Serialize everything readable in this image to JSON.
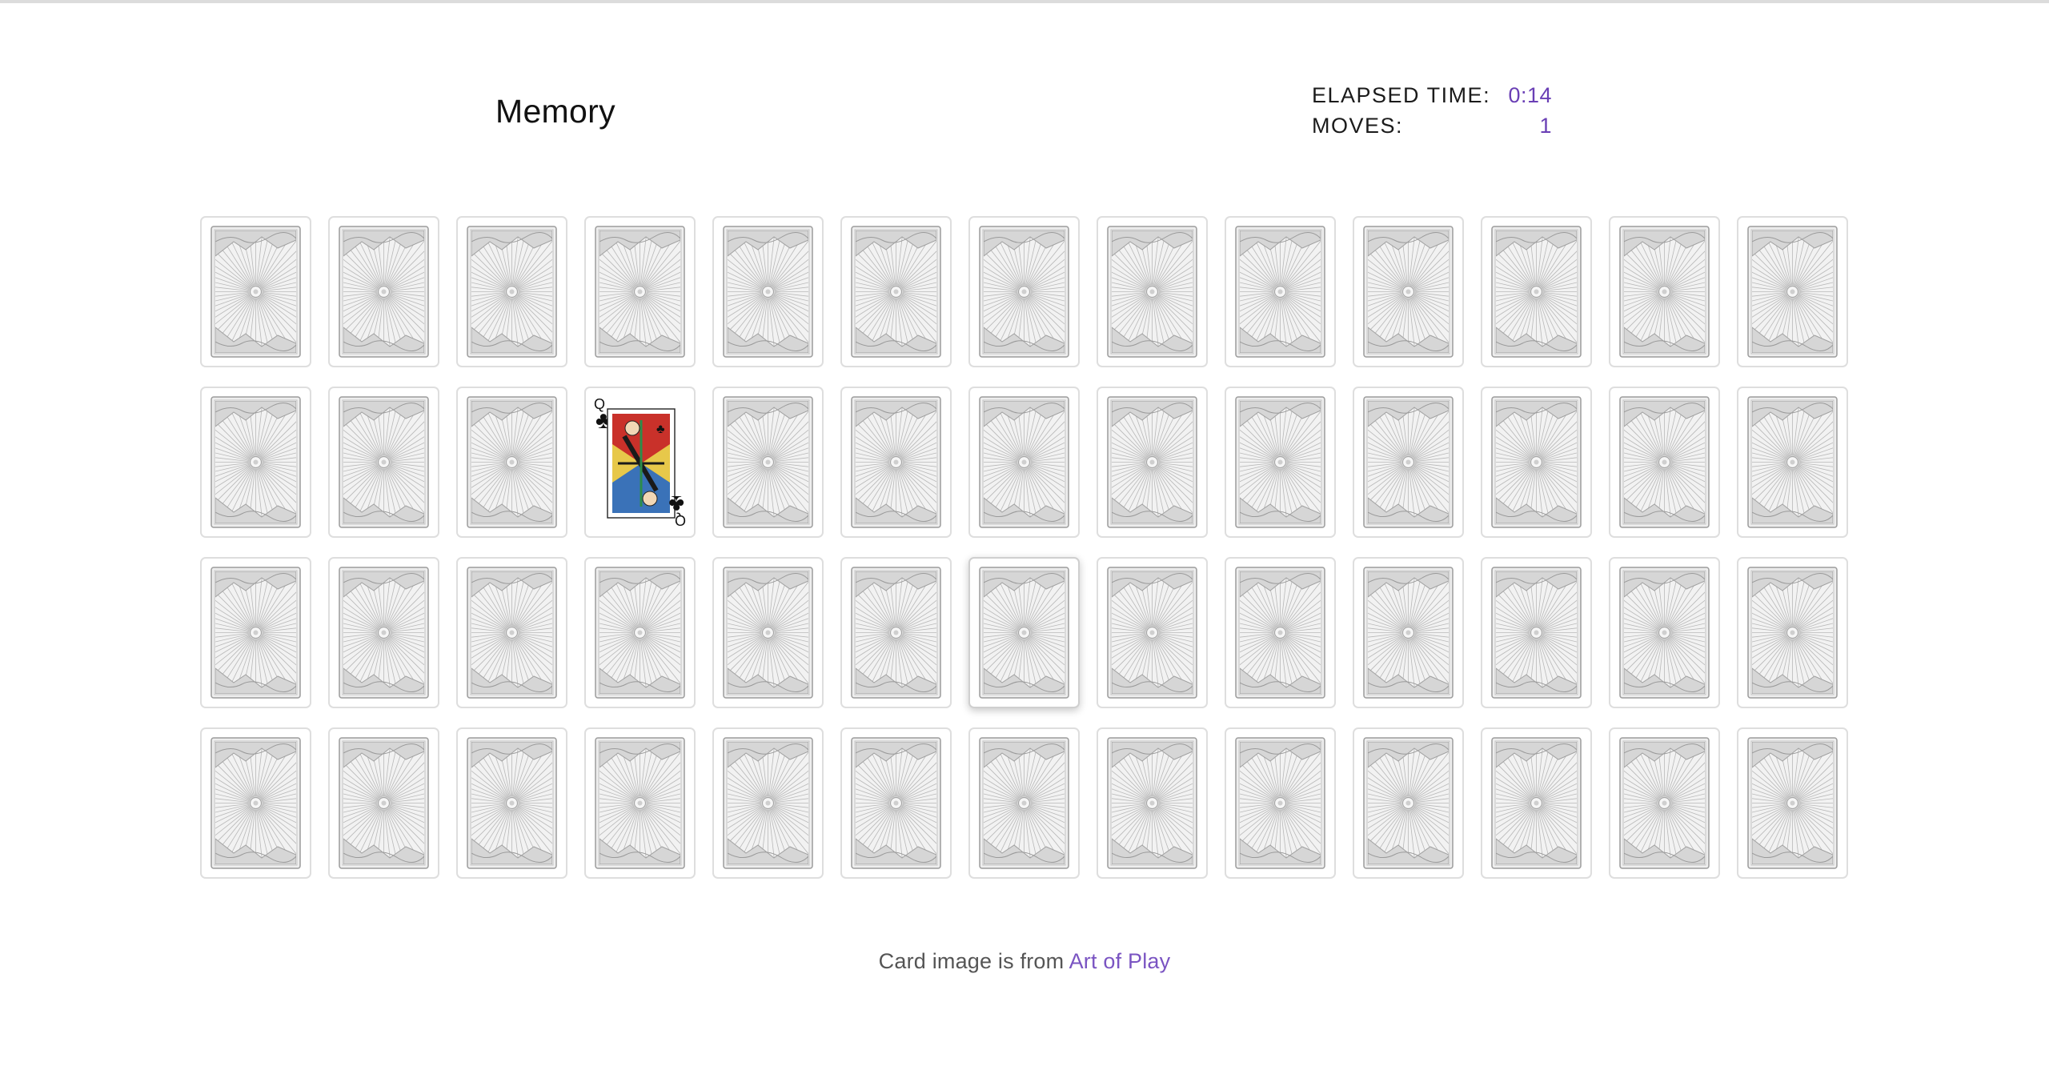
{
  "header": {
    "title": "Memory"
  },
  "stats": {
    "elapsed_label": "ELAPSED TIME:",
    "elapsed_value": "0:14",
    "moves_label": "MOVES:",
    "moves_value": "1"
  },
  "board": {
    "rows": 4,
    "columns": 13,
    "cards": [
      {
        "state": "face-down"
      },
      {
        "state": "face-down"
      },
      {
        "state": "face-down"
      },
      {
        "state": "face-down"
      },
      {
        "state": "face-down"
      },
      {
        "state": "face-down"
      },
      {
        "state": "face-down"
      },
      {
        "state": "face-down"
      },
      {
        "state": "face-down"
      },
      {
        "state": "face-down"
      },
      {
        "state": "face-down"
      },
      {
        "state": "face-down"
      },
      {
        "state": "face-down"
      },
      {
        "state": "face-down"
      },
      {
        "state": "face-down"
      },
      {
        "state": "face-down"
      },
      {
        "state": "face-up",
        "rank": "Q",
        "suit": "clubs",
        "suit_symbol": "♣"
      },
      {
        "state": "face-down"
      },
      {
        "state": "face-down"
      },
      {
        "state": "face-down"
      },
      {
        "state": "face-down"
      },
      {
        "state": "face-down"
      },
      {
        "state": "face-down"
      },
      {
        "state": "face-down"
      },
      {
        "state": "face-down"
      },
      {
        "state": "face-down"
      },
      {
        "state": "face-down"
      },
      {
        "state": "face-down"
      },
      {
        "state": "face-down"
      },
      {
        "state": "face-down"
      },
      {
        "state": "face-down"
      },
      {
        "state": "face-down"
      },
      {
        "state": "face-down",
        "hovered": true
      },
      {
        "state": "face-down"
      },
      {
        "state": "face-down"
      },
      {
        "state": "face-down"
      },
      {
        "state": "face-down"
      },
      {
        "state": "face-down"
      },
      {
        "state": "face-down"
      },
      {
        "state": "face-down"
      },
      {
        "state": "face-down"
      },
      {
        "state": "face-down"
      },
      {
        "state": "face-down"
      },
      {
        "state": "face-down"
      },
      {
        "state": "face-down"
      },
      {
        "state": "face-down"
      },
      {
        "state": "face-down"
      },
      {
        "state": "face-down"
      },
      {
        "state": "face-down"
      },
      {
        "state": "face-down"
      },
      {
        "state": "face-down"
      },
      {
        "state": "face-down"
      }
    ]
  },
  "footer": {
    "text": "Card image is from",
    "link_text": "Art of Play"
  },
  "colors": {
    "accent": "#6a3fb5",
    "link": "#7a54c2",
    "card_border": "#dedede",
    "card_back_line": "#a9a9a9"
  }
}
